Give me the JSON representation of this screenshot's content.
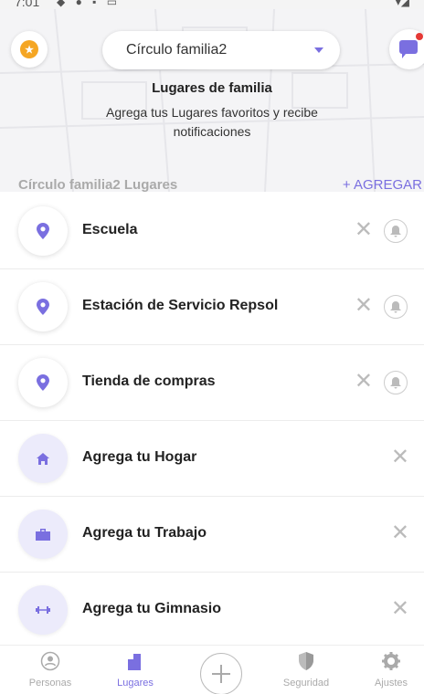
{
  "status_bar": {
    "time": "7:01"
  },
  "header": {
    "circle_name": "Círculo familia2",
    "promo_title": "Lugares de familia",
    "promo_text": "Agrega tus Lugares favoritos y recibe notificaciones"
  },
  "section": {
    "title": "Círculo familia2 Lugares",
    "add_label": "+ AGREGAR"
  },
  "places": [
    {
      "name": "Escuela",
      "icon": "map-pin-icon"
    },
    {
      "name": "Estación de Servicio Repsol",
      "icon": "map-pin-icon"
    },
    {
      "name": "Tienda de compras",
      "icon": "map-pin-icon"
    }
  ],
  "suggestions": [
    {
      "name": "Agrega tu Hogar",
      "icon": "home-icon"
    },
    {
      "name": "Agrega tu Trabajo",
      "icon": "briefcase-icon"
    },
    {
      "name": "Agrega tu Gimnasio",
      "icon": "dumbbell-icon"
    }
  ],
  "nav": {
    "personas": "Personas",
    "lugares": "Lugares",
    "seguridad": "Seguridad",
    "ajustes": "Ajustes"
  },
  "colors": {
    "accent": "#7a6fe0",
    "badge": "#f5a623",
    "notification_dot": "#e53935"
  }
}
